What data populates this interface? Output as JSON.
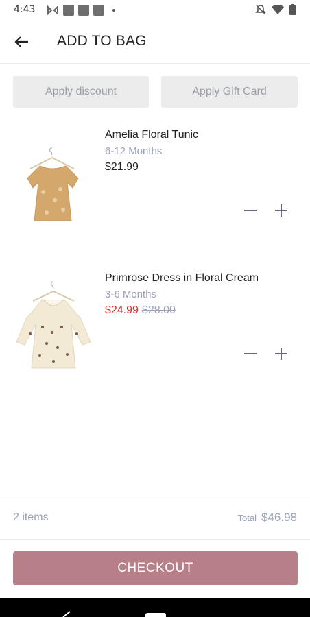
{
  "status_bar": {
    "time": "4:43"
  },
  "header": {
    "title": "ADD TO BAG"
  },
  "promo": {
    "discount_label": "Apply discount",
    "gift_card_label": "Apply Gift Card"
  },
  "cart": {
    "items": [
      {
        "name": "Amelia Floral Tunic",
        "size": "6-12 Months",
        "price": "$21.99"
      },
      {
        "name": "Primrose Dress in Floral Cream",
        "size": "3-6 Months",
        "sale_price": "$24.99",
        "original_price": "$28.00"
      }
    ]
  },
  "summary": {
    "count": "2 items",
    "total_label": "Total",
    "total": "$46.98"
  },
  "checkout_label": "CHECKOUT",
  "colors": {
    "accent": "#b77f87",
    "sale": "#d2302f",
    "muted": "#9aa0b8"
  }
}
